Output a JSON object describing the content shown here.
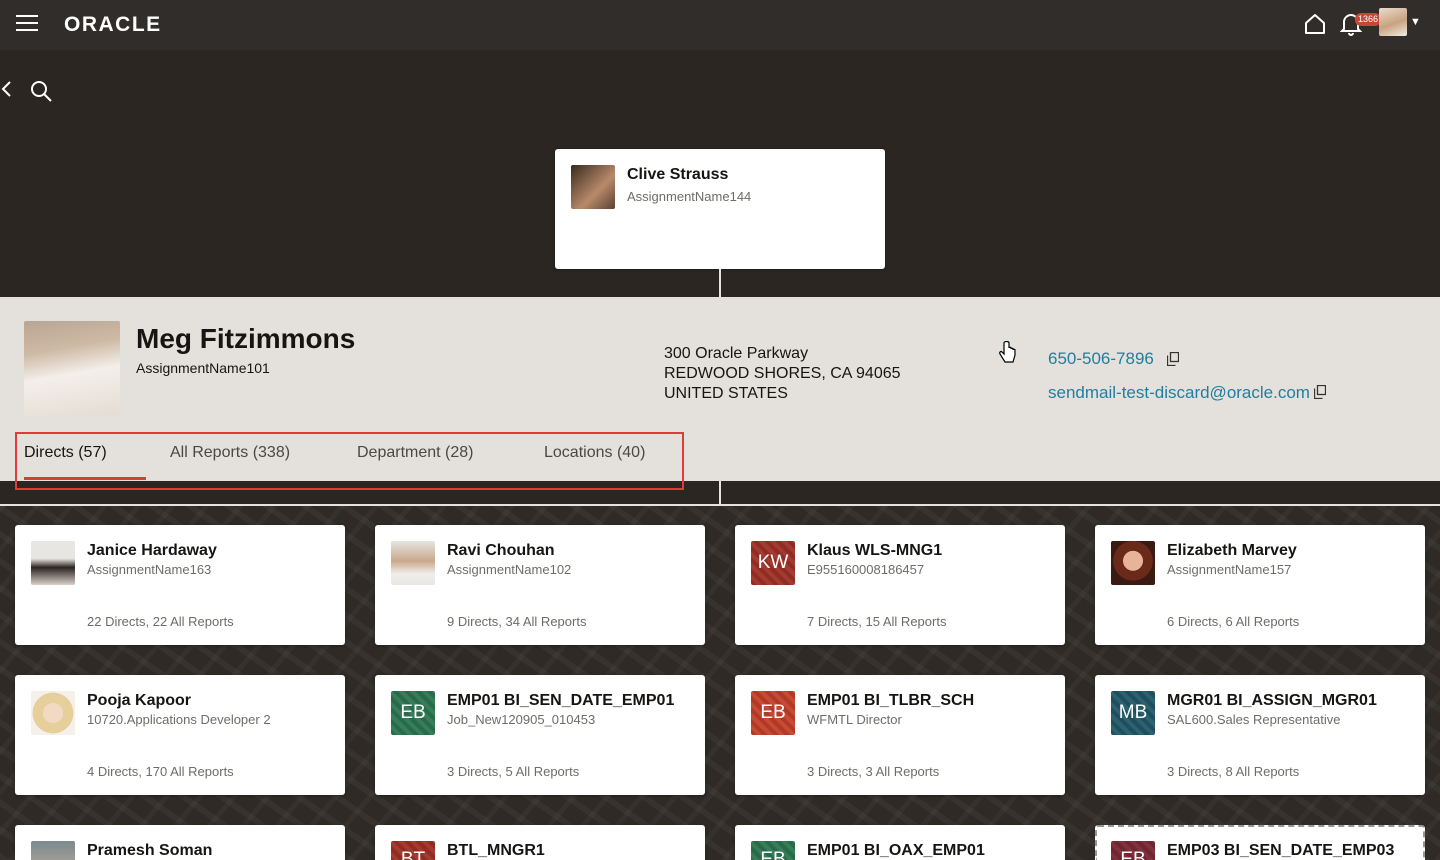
{
  "header": {
    "logo": "ORACLE",
    "notification_count": "1366"
  },
  "manager": {
    "name": "Clive Strauss",
    "assignment": "AssignmentName144"
  },
  "focus": {
    "name": "Meg Fitzimmons",
    "assignment": "AssignmentName101",
    "address_line1": "300 Oracle Parkway",
    "address_line2": "REDWOOD SHORES, CA 94065",
    "address_line3": "UNITED STATES",
    "phone": "650-506-7896",
    "email": "sendmail-test-discard@oracle.com"
  },
  "tabs": [
    {
      "label": "Directs (57)"
    },
    {
      "label": "All Reports (338)"
    },
    {
      "label": "Department (28)"
    },
    {
      "label": "Locations (40)"
    }
  ],
  "directs": [
    {
      "name": "Janice Hardaway",
      "sub": "AssignmentName163",
      "meta": "22 Directs, 22 All Reports"
    },
    {
      "name": "Ravi Chouhan",
      "sub": "AssignmentName102",
      "meta": "9 Directs, 34 All Reports"
    },
    {
      "name": "Klaus WLS-MNG1",
      "sub": "E955160008186457",
      "meta": "7 Directs, 15 All Reports",
      "initials": "KW"
    },
    {
      "name": "Elizabeth Marvey",
      "sub": "AssignmentName157",
      "meta": "6 Directs, 6 All Reports"
    },
    {
      "name": "Pooja Kapoor",
      "sub": "10720.Applications Developer 2",
      "meta": "4 Directs, 170 All Reports"
    },
    {
      "name": "EMP01 BI_SEN_DATE_EMP01",
      "sub": "Job_New120905_010453",
      "meta": "3 Directs, 5 All Reports",
      "initials": "EB"
    },
    {
      "name": "EMP01 BI_TLBR_SCH",
      "sub": "WFMTL Director",
      "meta": "3 Directs, 3 All Reports",
      "initials": "EB"
    },
    {
      "name": "MGR01 BI_ASSIGN_MGR01",
      "sub": "SAL600.Sales Representative",
      "meta": "3 Directs, 8 All Reports",
      "initials": "MB"
    },
    {
      "name": "Pramesh Soman"
    },
    {
      "name": "BTL_MNGR1",
      "initials": "BT"
    },
    {
      "name": "EMP01 BI_OAX_EMP01",
      "initials": "EB"
    },
    {
      "name": "EMP03 BI_SEN_DATE_EMP03",
      "initials": "EB"
    }
  ]
}
